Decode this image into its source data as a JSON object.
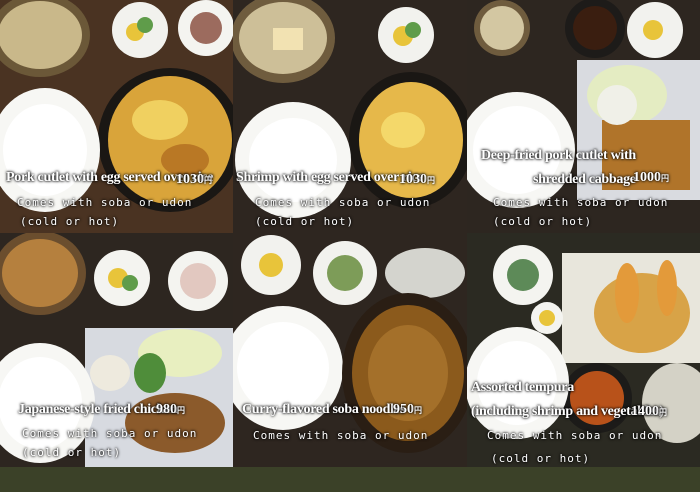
{
  "items": [
    {
      "title": "Pork cutlet with egg served over rice",
      "price": "1030",
      "yen": "円",
      "line1": "Comes with soba or udon",
      "line2": "(cold or hot)"
    },
    {
      "title": "Shrimp with egg served over rice",
      "price": "1030",
      "yen": "円",
      "line1": "Comes with soba or udon",
      "line2": "(cold or hot)"
    },
    {
      "title_line1": "Deep-fried pork cutlet with",
      "title_line2": "shredded cabbage",
      "price": "1000",
      "yen": "円",
      "line1": "Comes with soba or udon",
      "line2": "(cold or hot)"
    },
    {
      "title": "Japanese-style fried chicken",
      "price": "980",
      "yen": "円",
      "line1": "Comes with soba or udon",
      "line2": "(cold or hot)"
    },
    {
      "title": "Curry-flavored soba noodles",
      "price": "950",
      "yen": "円",
      "line1": "Comes with soba or udon"
    },
    {
      "title_line1": "Assorted tempura",
      "title_line2": "(including shrimp and vegetables)",
      "price": "1400",
      "yen": "円",
      "line1": "Comes with soba or udon",
      "line2": "(cold or hot)"
    }
  ]
}
